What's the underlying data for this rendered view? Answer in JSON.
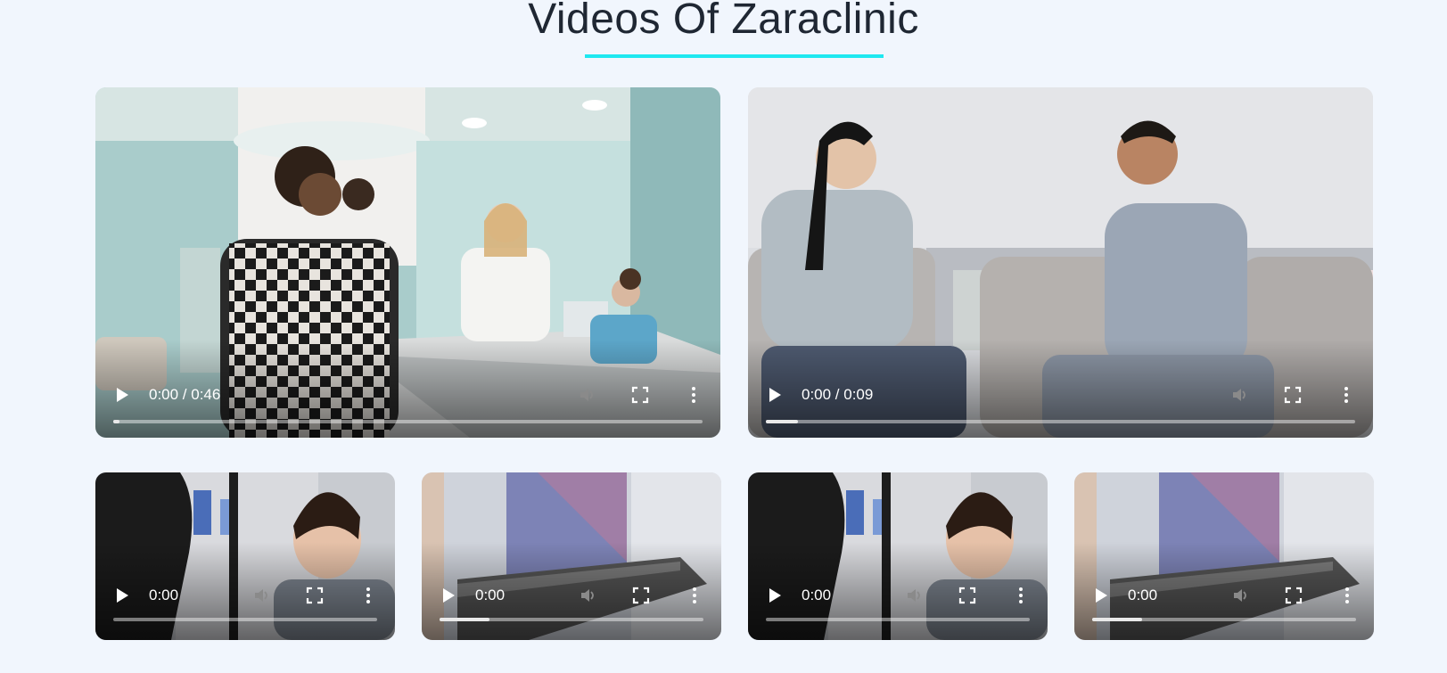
{
  "page": {
    "title": "Videos Of Zaraclinic"
  },
  "videos": [
    {
      "time": "0:00 / 0:46",
      "buffered": 0.01
    },
    {
      "time": "0:00 / 0:09",
      "buffered": 0.055
    },
    {
      "time": "0:00",
      "buffered": 0.0
    },
    {
      "time": "0:00",
      "buffered": 0.19
    },
    {
      "time": "0:00",
      "buffered": 0.0
    },
    {
      "time": "0:00",
      "buffered": 0.19
    }
  ],
  "icons": {
    "play": "play-icon",
    "mute": "volume-muted-icon",
    "fullscreen": "fullscreen-icon",
    "more": "more-vertical-icon"
  },
  "colors": {
    "background": "#f1f6fd",
    "title": "#1f2733",
    "accent": "#1fe8f0"
  }
}
